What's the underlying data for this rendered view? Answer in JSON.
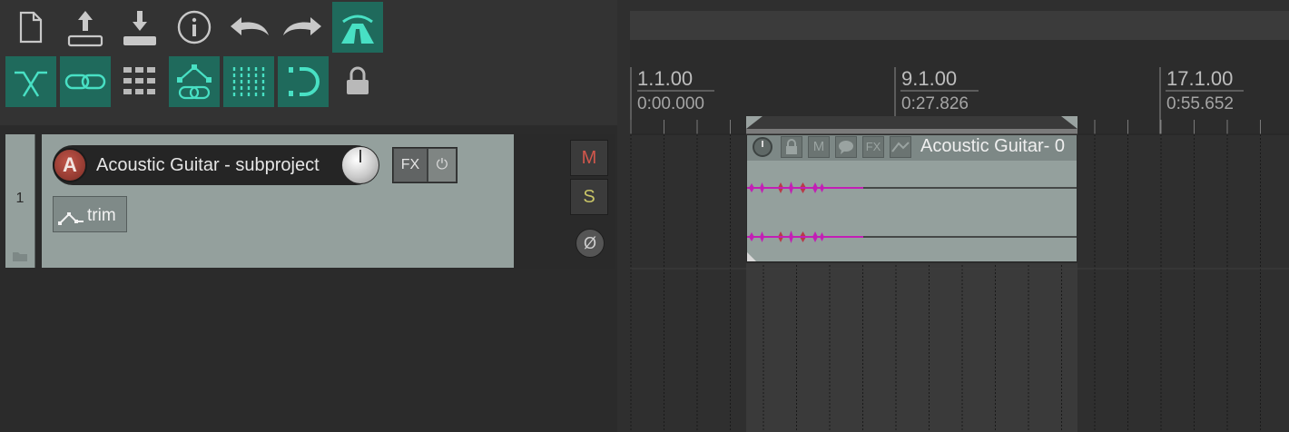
{
  "toolbar": {
    "buttons_row1": [
      {
        "name": "new-project-icon",
        "active": false
      },
      {
        "name": "open-project-icon",
        "active": false
      },
      {
        "name": "save-project-icon",
        "active": false
      },
      {
        "name": "project-info-icon",
        "active": false
      },
      {
        "name": "undo-icon",
        "active": false
      },
      {
        "name": "redo-icon",
        "active": false
      },
      {
        "name": "metronome-road-icon",
        "active": true
      }
    ],
    "buttons_row2": [
      {
        "name": "auto-crossfade-icon",
        "active": true
      },
      {
        "name": "item-grouping-icon",
        "active": true
      },
      {
        "name": "grid-icon",
        "active": false
      },
      {
        "name": "envelope-points-icon",
        "active": true
      },
      {
        "name": "snap-grid-icon",
        "active": true
      },
      {
        "name": "ripple-edit-icon",
        "active": true
      },
      {
        "name": "lock-icon",
        "active": false
      }
    ]
  },
  "track": {
    "number": "1",
    "avatar_letter": "A",
    "name": "Acoustic Guitar - subproject",
    "fx_label": "FX",
    "fx_power": "⏻",
    "trim_label": "trim",
    "mute_label": "M",
    "solo_label": "S",
    "phase_label": "Ø"
  },
  "ruler": {
    "markers": [
      {
        "measure": "1.1.00",
        "time": "0:00.000"
      },
      {
        "measure": "9.1.00",
        "time": "0:27.826"
      },
      {
        "measure": "17.1.00",
        "time": "0:55.652"
      }
    ]
  },
  "item": {
    "title": "Acoustic Guitar- 0"
  },
  "colors": {
    "accent": "#1f6a5c",
    "track_bg": "#94a09d",
    "waveform": "#c21fb5",
    "waveform_peak": "#b83a48"
  }
}
